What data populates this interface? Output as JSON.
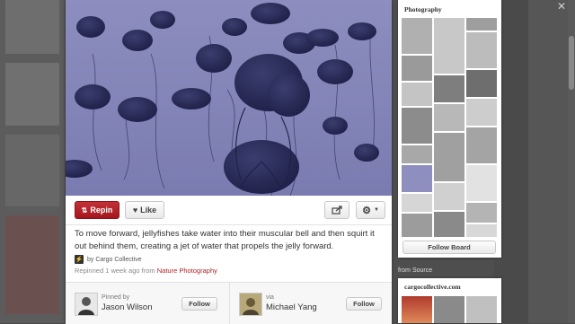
{
  "pin": {
    "repin_label": "Repin",
    "like_label": "Like",
    "description": "To move forward, jellyfishes take water into their muscular bell and then squirt it out behind them, creating a jet of water that propels the jelly forward.",
    "source_by": "by Cargo Collective",
    "repinned_prefix": "Repinned 1 week ago from",
    "repinned_board": "Nature Photography"
  },
  "credits": {
    "pinned_by_label": "Pinned by",
    "pinned_by_name": "Jason Wilson",
    "via_label": "via",
    "via_name": "Michael Yang",
    "follow_label": "Follow"
  },
  "board": {
    "title": "Photography",
    "follow_board_label": "Follow Board"
  },
  "source": {
    "heading": "from Source",
    "site": "cargocollective.com"
  },
  "icons": {
    "repin": "pushpin-icon",
    "like": "heart-icon",
    "share": "share-icon",
    "settings": "gear-icon",
    "source": "cargo-icon",
    "close": "close-icon"
  },
  "colors": {
    "accent": "#b21e25",
    "image_tint": "#8e8fbf"
  }
}
